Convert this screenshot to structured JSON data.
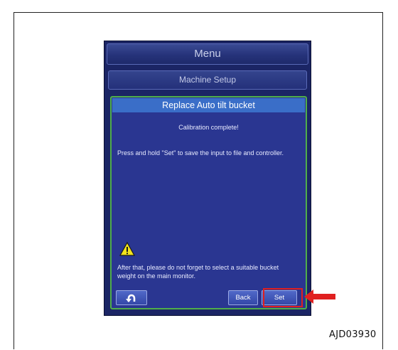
{
  "header": {
    "menu_title": "Menu"
  },
  "subheader": {
    "title": "Machine Setup"
  },
  "dialog": {
    "title": "Replace Auto tilt bucket",
    "status_message": "Calibration complete!",
    "instruction": "Press and hold \"Set\" to save the input to file and controller.",
    "warning_icon": "warning-triangle-icon",
    "warning_text": "After that, please do not forget to select a suitable bucket weight on the main monitor."
  },
  "buttons": {
    "undo_icon": "undo-arrow-icon",
    "back_label": "Back",
    "set_label": "Set"
  },
  "annotation": {
    "pointer": "red-arrow-icon",
    "highlight_color": "#e02020"
  },
  "figure_id": "AJD03930"
}
